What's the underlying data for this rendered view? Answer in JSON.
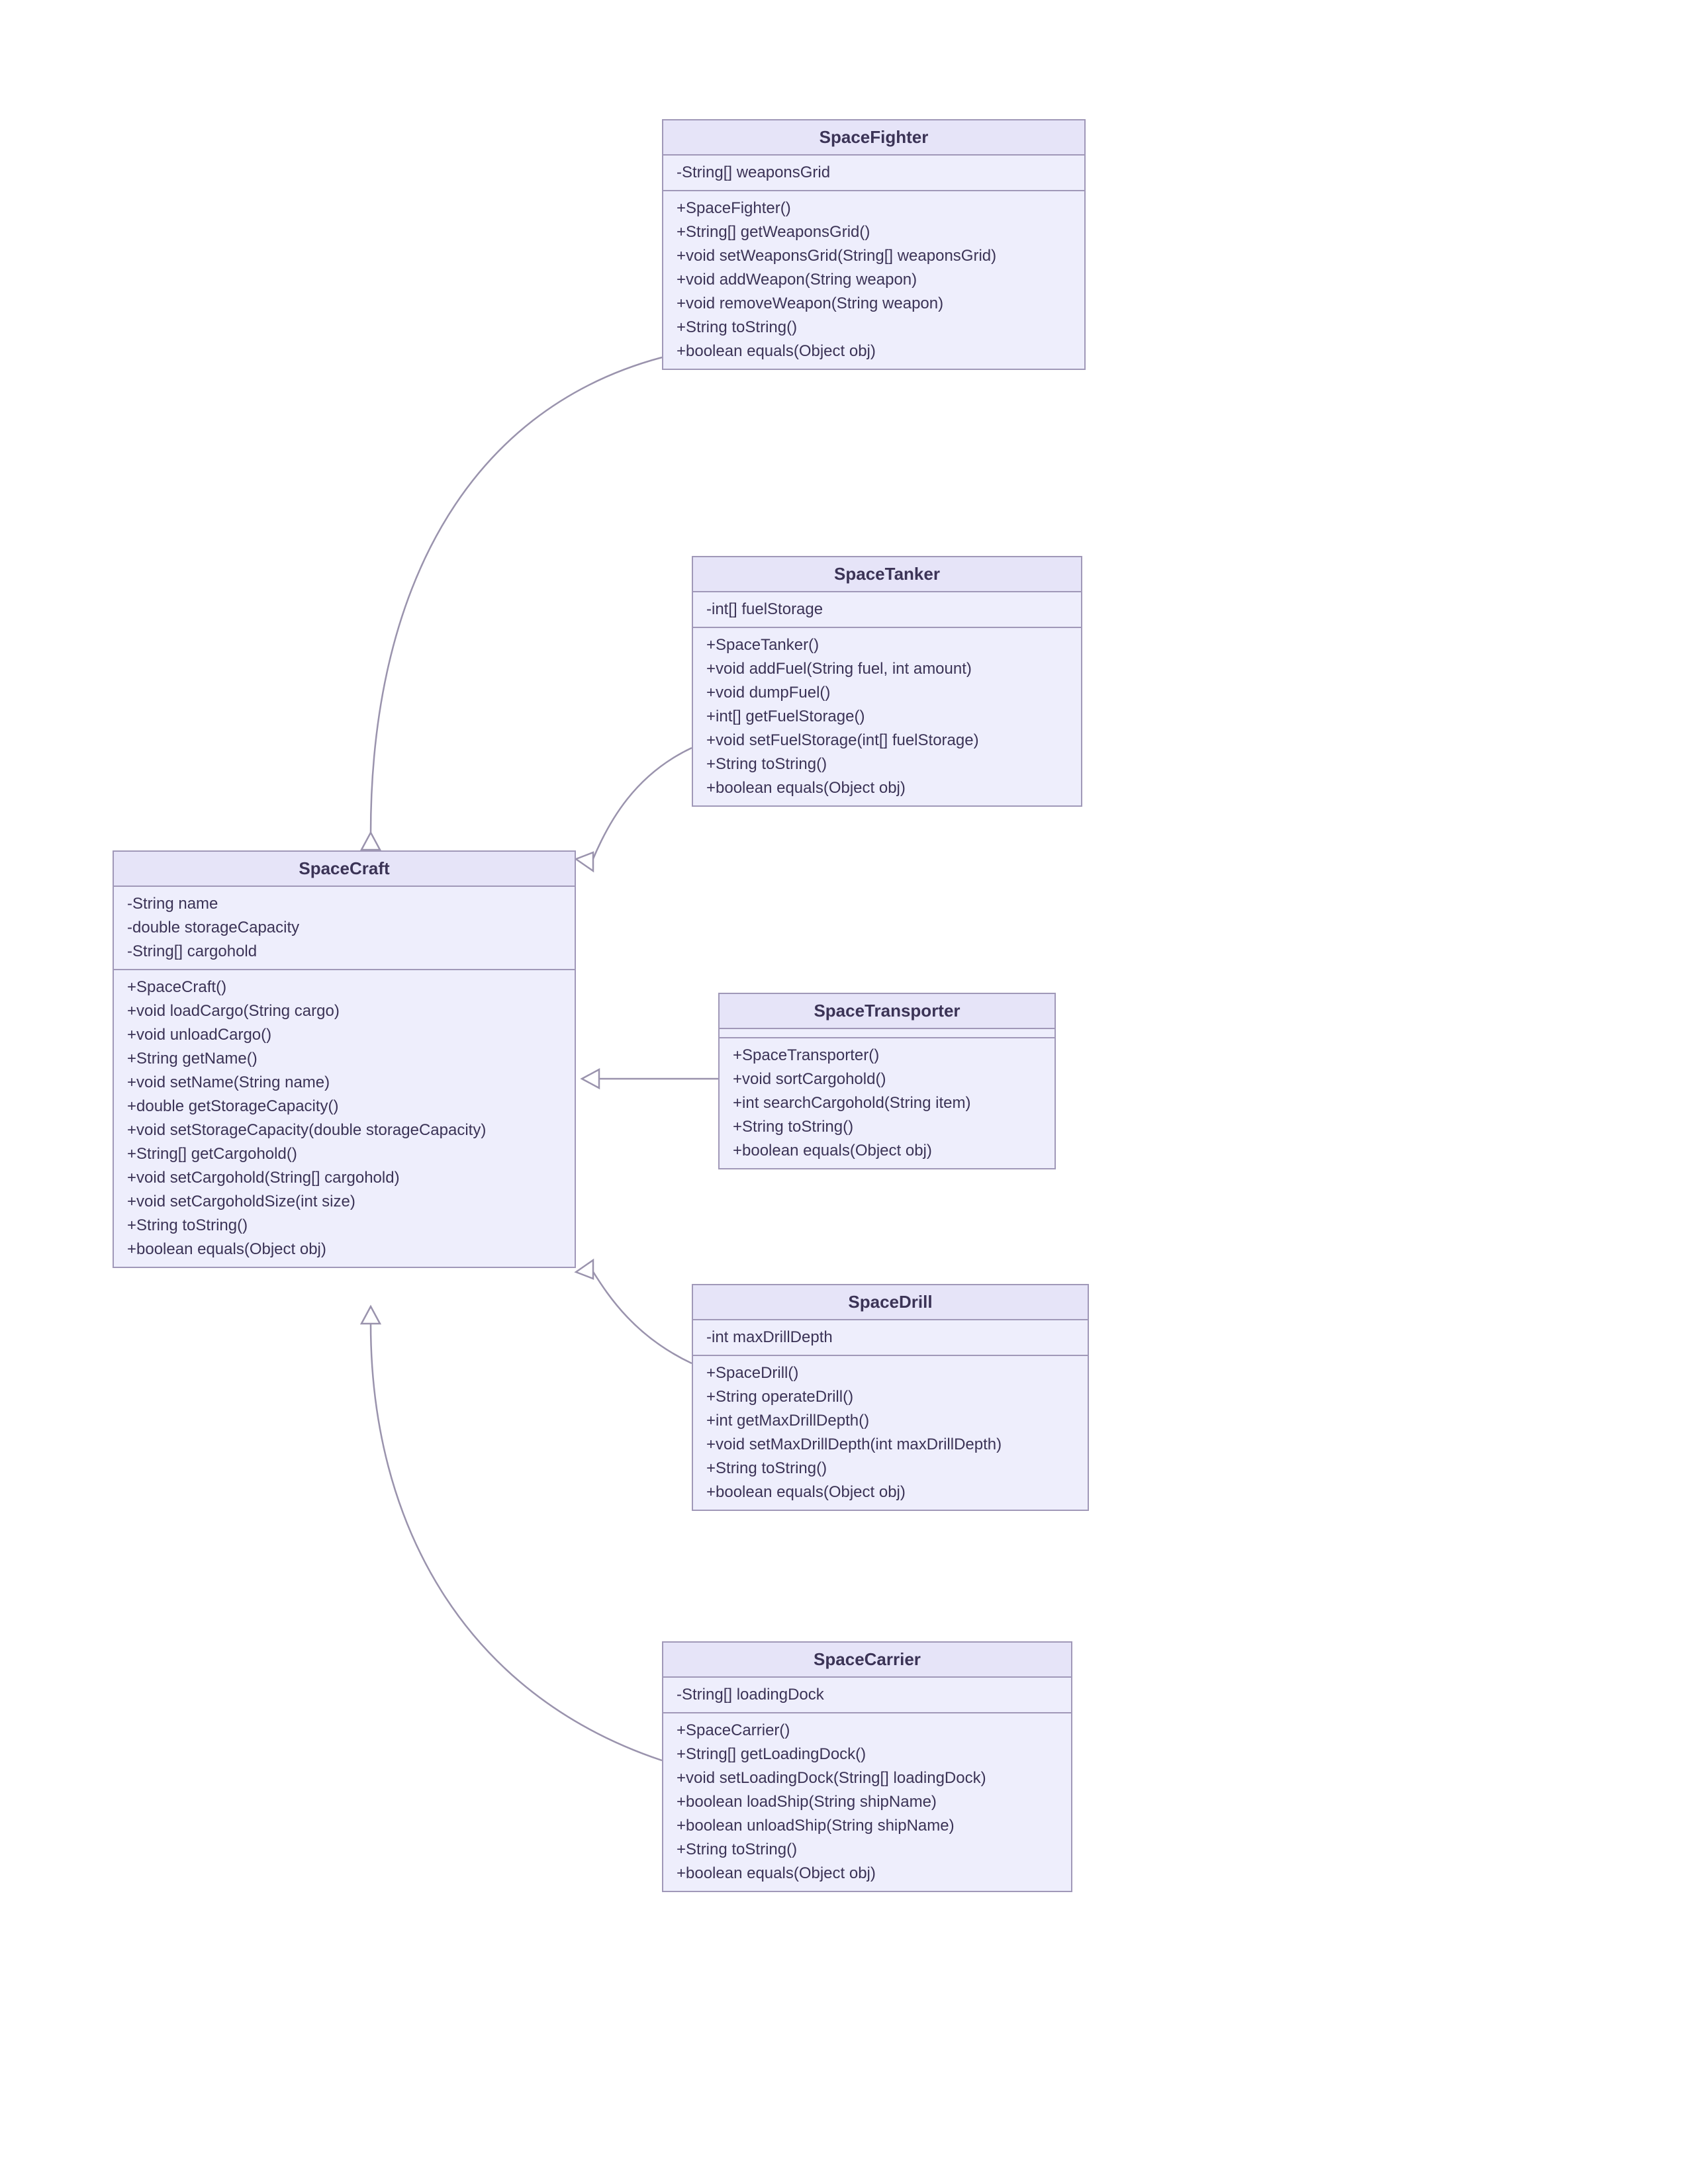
{
  "diagram": {
    "type": "uml-class-diagram",
    "parent": "SpaceCraft",
    "classes": {
      "SpaceCraft": {
        "name": "SpaceCraft",
        "attributes": [
          "-String name",
          "-double storageCapacity",
          "-String[] cargohold"
        ],
        "methods": [
          "+SpaceCraft()",
          "+void loadCargo(String cargo)",
          "+void unloadCargo()",
          "+String getName()",
          "+void setName(String name)",
          "+double getStorageCapacity()",
          "+void setStorageCapacity(double storageCapacity)",
          "+String[] getCargohold()",
          "+void setCargohold(String[] cargohold)",
          "+void setCargoholdSize(int size)",
          "+String toString()",
          "+boolean equals(Object obj)"
        ]
      },
      "SpaceFighter": {
        "name": "SpaceFighter",
        "attributes": [
          "-String[] weaponsGrid"
        ],
        "methods": [
          "+SpaceFighter()",
          "+String[] getWeaponsGrid()",
          "+void setWeaponsGrid(String[] weaponsGrid)",
          "+void addWeapon(String weapon)",
          "+void removeWeapon(String weapon)",
          "+String toString()",
          "+boolean equals(Object obj)"
        ]
      },
      "SpaceTanker": {
        "name": "SpaceTanker",
        "attributes": [
          "-int[] fuelStorage"
        ],
        "methods": [
          "+SpaceTanker()",
          "+void addFuel(String fuel, int amount)",
          "+void dumpFuel()",
          "+int[] getFuelStorage()",
          "+void setFuelStorage(int[] fuelStorage)",
          "+String toString()",
          "+boolean equals(Object obj)"
        ]
      },
      "SpaceTransporter": {
        "name": "SpaceTransporter",
        "attributes": [],
        "methods": [
          "+SpaceTransporter()",
          "+void sortCargohold()",
          "+int searchCargohold(String item)",
          "+String toString()",
          "+boolean equals(Object obj)"
        ]
      },
      "SpaceDrill": {
        "name": "SpaceDrill",
        "attributes": [
          "-int maxDrillDepth"
        ],
        "methods": [
          "+SpaceDrill()",
          "+String operateDrill()",
          "+int getMaxDrillDepth()",
          "+void setMaxDrillDepth(int maxDrillDepth)",
          "+String toString()",
          "+boolean equals(Object obj)"
        ]
      },
      "SpaceCarrier": {
        "name": "SpaceCarrier",
        "attributes": [
          "-String[] loadingDock"
        ],
        "methods": [
          "+SpaceCarrier()",
          "+String[] getLoadingDock()",
          "+void setLoadingDock(String[] loadingDock)",
          "+boolean loadShip(String shipName)",
          "+boolean unloadShip(String shipName)",
          "+String toString()",
          "+boolean equals(Object obj)"
        ]
      }
    },
    "generalizations": [
      {
        "child": "SpaceFighter",
        "parent": "SpaceCraft"
      },
      {
        "child": "SpaceTanker",
        "parent": "SpaceCraft"
      },
      {
        "child": "SpaceTransporter",
        "parent": "SpaceCraft"
      },
      {
        "child": "SpaceDrill",
        "parent": "SpaceCraft"
      },
      {
        "child": "SpaceCarrier",
        "parent": "SpaceCraft"
      }
    ]
  }
}
